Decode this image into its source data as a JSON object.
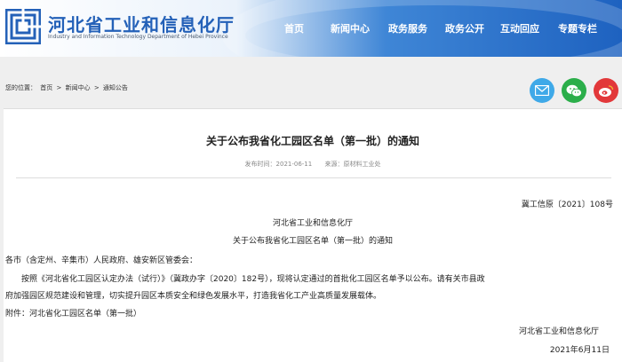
{
  "header": {
    "site_title": "河北省工业和信息化厅",
    "site_subtitle": "Industry and Information Technology Department of Hebei Province",
    "brand_color": "#2461b8"
  },
  "nav": {
    "items": [
      {
        "label": "首页"
      },
      {
        "label": "新闻中心"
      },
      {
        "label": "政务服务"
      },
      {
        "label": "政务公开"
      },
      {
        "label": "互动回应"
      },
      {
        "label": "专题专栏"
      }
    ]
  },
  "breadcrumb": {
    "prefix": "您的位置：",
    "items": [
      "首页",
      "新闻中心",
      "通知公告"
    ],
    "separator": ">"
  },
  "share": {
    "icons": [
      "mail-icon",
      "wechat-icon",
      "weibo-icon"
    ]
  },
  "article": {
    "title": "关于公布我省化工园区名单（第一批）的通知",
    "publish_time": "发布时间：2021-06-11",
    "source": "来源：原材料工业处",
    "doc_number": "冀工信原〔2021〕108号",
    "issuer": "河北省工业和信息化厅",
    "notice_title": "关于公布我省化工园区名单（第一批）的通知",
    "addressee": "各市（含定州、辛集市）人民政府、雄安新区管委会：",
    "para1": "按照《河北省化工园区认定办法（试行）》（冀政办字〔2020〕182号），现将认定通过的首批化工园区名单予以公布。请有关市县政",
    "para2": "府加强园区规范建设和管理，切实提升园区本质安全和绿色发展水平，打造我省化工产业高质量发展载体。",
    "attachment": "附件：河北省化工园区名单（第一批）",
    "signature": "河北省工业和信息化厅",
    "date": "2021年6月11日"
  }
}
